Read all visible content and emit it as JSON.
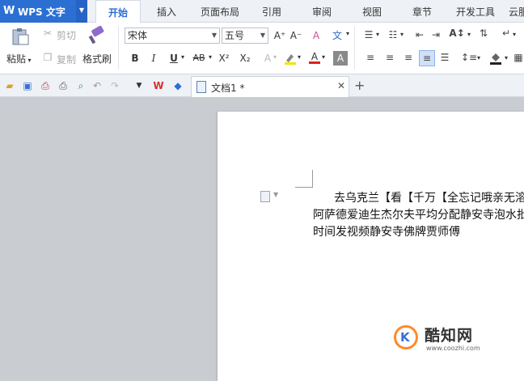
{
  "app": {
    "name": "WPS 文字",
    "logo_letter": "W"
  },
  "menu_tabs": [
    {
      "label": "开始",
      "active": true
    },
    {
      "label": "插入",
      "active": false
    },
    {
      "label": "页面布局",
      "active": false
    },
    {
      "label": "引用",
      "active": false
    },
    {
      "label": "审阅",
      "active": false
    },
    {
      "label": "视图",
      "active": false
    },
    {
      "label": "章节",
      "active": false
    },
    {
      "label": "开发工具",
      "active": false
    },
    {
      "label": "云服",
      "active": false
    }
  ],
  "ribbon": {
    "paste_label": "粘贴",
    "cut_label": "剪切",
    "copy_label": "复制",
    "format_painter_label": "格式刷",
    "font_name": "宋体",
    "font_size": "五号",
    "bold": "B",
    "italic": "I",
    "underline": "U",
    "strikethrough": "AB",
    "superscript": "X²",
    "subscript": "X₂",
    "font_color_letter": "A",
    "char_shading_letter": "A",
    "phonetic_glyph": "文",
    "grow_font": "A⁺",
    "shrink_font": "A⁻",
    "clear_format": "A",
    "accent_color": "#2b6fd3"
  },
  "doc_tab": {
    "title": "文档1 *"
  },
  "document": {
    "lines": [
      "去乌克兰【看【千万【全忘记哦亲无溶剂",
      "阿萨德爱迪生杰尔夫平均分配静安寺泡水批",
      "时间发视频静安寺佛牌贾师傅"
    ]
  },
  "watermark": {
    "name": "酷知网",
    "url": "www.coozhi.com"
  }
}
